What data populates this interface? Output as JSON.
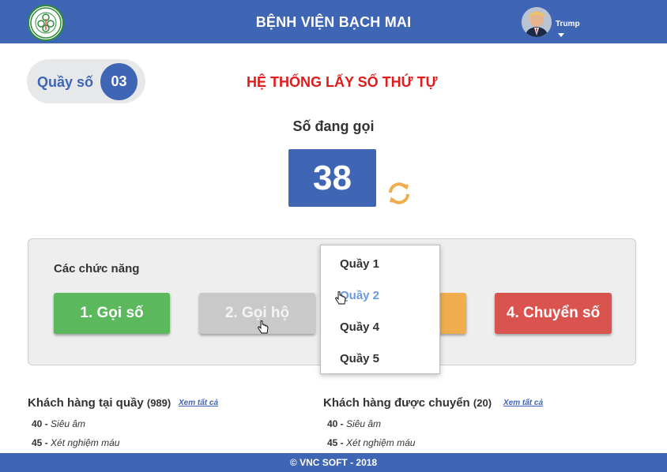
{
  "header": {
    "title": "BỆNH VIỆN BẠCH MAI",
    "user_name": "Trump",
    "logo_text": "BỆNH VIỆN BẠCH MAI · BACH MAI HOSPITAL"
  },
  "counter": {
    "label": "Quầy số",
    "number": "03"
  },
  "page_title": "HỆ THỐNG LẤY SỐ THỨ TỰ",
  "calling": {
    "label": "Số đang gọi",
    "number": "38"
  },
  "functions": {
    "title": "Các chức năng",
    "buttons": [
      {
        "label": "1. Gọi số",
        "color": "#5cb85c"
      },
      {
        "label": "2. Gọi hộ",
        "color": "#c9c9c9"
      },
      {
        "label": "",
        "color": "#f0ad4e"
      },
      {
        "label": "4. Chuyển số",
        "color": "#d9534f"
      }
    ]
  },
  "dropdown": {
    "items": [
      "Quầy 1",
      "Quầy 2",
      "Quầy 4",
      "Quầy 5"
    ],
    "hovered": "Quầy 2"
  },
  "lists": {
    "at_counter": {
      "title": "Khách hàng tại quầy",
      "count": "(989)",
      "see_all": "Xem tất cả",
      "rows": [
        {
          "num": "40 -",
          "service": "Siêu âm"
        },
        {
          "num": "45 -",
          "service": "Xét nghiệm máu"
        }
      ]
    },
    "transferred": {
      "title": "Khách hàng được chuyển",
      "count": "(20)",
      "see_all": "Xem tất cả",
      "rows": [
        {
          "num": "40 -",
          "service": "Siêu âm"
        },
        {
          "num": "45 -",
          "service": "Xét nghiệm máu"
        }
      ]
    }
  },
  "footer": {
    "text": "© VNC SOFT - 2018"
  },
  "colors": {
    "primary": "#3f65b5",
    "title_red": "#e01b1b",
    "refresh_orange": "#f0ad4e"
  },
  "icons": [
    "hospital-logo",
    "user-avatar",
    "caret-down-icon",
    "refresh-icon",
    "hand-cursor-icon"
  ]
}
